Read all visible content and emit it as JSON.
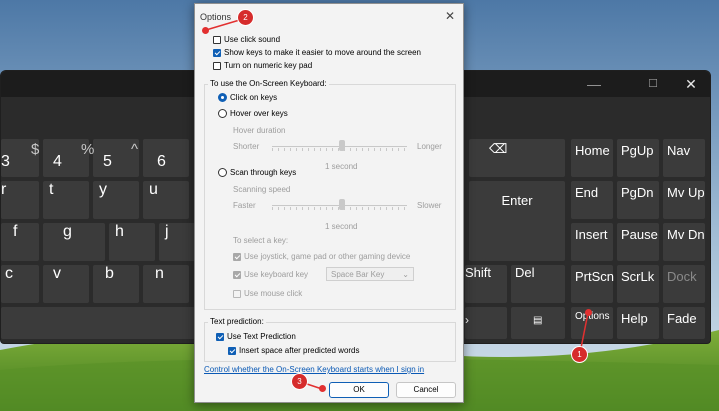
{
  "keyboard": {
    "number_row": [
      {
        "sym": "$",
        "main": "3"
      },
      {
        "sym": "$",
        "main": "4"
      },
      {
        "sym": "%",
        "main": "5"
      },
      {
        "sym": "^",
        "main": "6"
      },
      {
        "sym": "&",
        "main": ""
      }
    ],
    "qwerty_row": [
      "r",
      "t",
      "y",
      "u"
    ],
    "home_row": [
      "f",
      "g",
      "h",
      "j"
    ],
    "bottom_row": [
      "c",
      "v",
      "b",
      "n"
    ],
    "backspace_icon": "backspace-icon",
    "enter_label": "Enter",
    "shift_label": "Shift",
    "del_label": "Del",
    "menu_icon": "menu-icon",
    "nav_keys": [
      "Home",
      "PgUp",
      "Nav",
      "End",
      "PgDn",
      "Mv Up",
      "Insert",
      "Pause",
      "Mv Dn",
      "PrtScn",
      "ScrLk",
      "Dock",
      "Options",
      "Help",
      "Fade"
    ],
    "caption": {
      "minimize": "—",
      "maximize": "☐",
      "close": "✕"
    }
  },
  "dialog": {
    "title": "Options",
    "close": "✕",
    "checkboxes_top": [
      {
        "label": "Use click sound",
        "checked": false
      },
      {
        "label": "Show keys to make it easier to move around the screen",
        "checked": true
      },
      {
        "label": "Turn on numeric key pad",
        "checked": false
      }
    ],
    "use_group_label": "To use the On-Screen Keyboard:",
    "click_on_keys": "Click on keys",
    "hover_over_keys": "Hover over keys",
    "hover_duration": "Hover duration",
    "shorter": "Shorter",
    "longer": "Longer",
    "hover_value": "1 second",
    "scan_through_keys": "Scan through keys",
    "scanning_speed": "Scanning speed",
    "faster": "Faster",
    "slower": "Slower",
    "scan_value": "1 second",
    "to_select_key": "To select a key:",
    "joystick": "Use joystick, game pad or other gaming device",
    "use_keyboard_key": "Use keyboard key",
    "keyboard_key_value": "Space Bar Key",
    "use_mouse_click": "Use mouse click",
    "text_prediction_label": "Text prediction:",
    "use_text_prediction": "Use Text Prediction",
    "insert_space": "Insert space after predicted words",
    "control_link": "Control whether the On-Screen Keyboard starts when I sign in",
    "ok": "OK",
    "cancel": "Cancel"
  },
  "annotations": {
    "one": "1",
    "two": "2",
    "three": "3"
  },
  "colors": {
    "accent": "#0f5fb5",
    "badge": "#d62c2c",
    "key": "#3b3b3b"
  }
}
